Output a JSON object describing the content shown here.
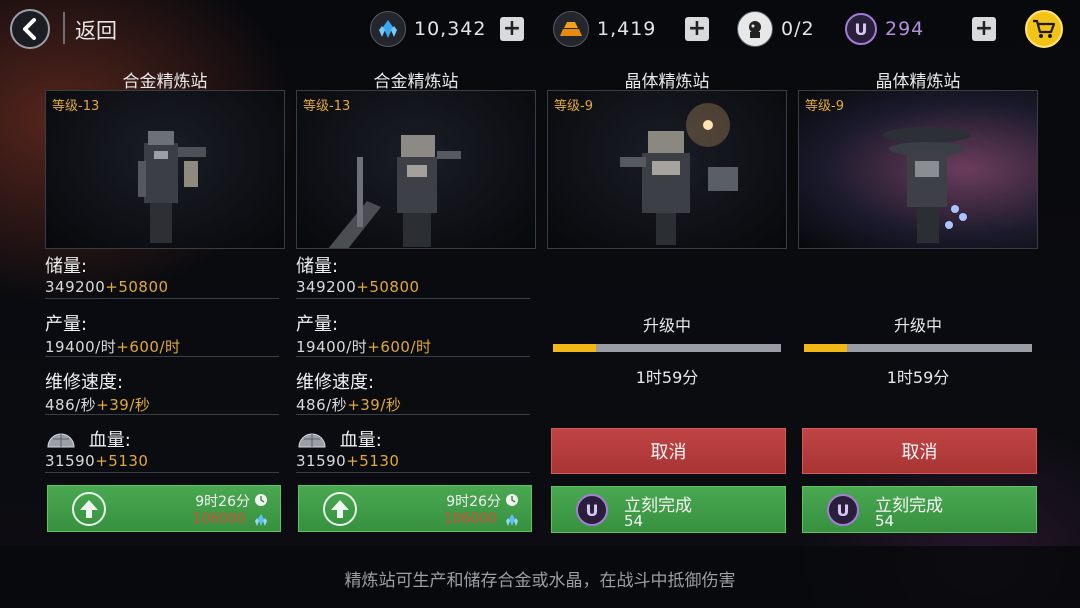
{
  "nav": {
    "back_label": "返回"
  },
  "resources": {
    "crystal": {
      "icon": "crystal-icon",
      "value": "10,342"
    },
    "alloy": {
      "icon": "alloy-bar-icon",
      "value": "1,419"
    },
    "pilot": {
      "icon": "pilot-icon",
      "value": "0/2"
    },
    "premium": {
      "icon": "u-coin-icon",
      "symbol": "U",
      "value": "294"
    }
  },
  "cards": [
    {
      "title": "合金精炼站",
      "level": "等级-13",
      "state": "upgrade",
      "storage_label": "储量:",
      "storage_value": "349200",
      "storage_bonus": "+50800",
      "production_label": "产量:",
      "production_value": "19400/时",
      "production_bonus": "+600/时",
      "repair_label": "维修速度:",
      "repair_value": "486/秒",
      "repair_bonus": "+39/秒",
      "hp_label": "血量:",
      "hp_value": "31590",
      "hp_bonus": "+5130",
      "upgrade_time": "9时26分",
      "upgrade_cost": "106000"
    },
    {
      "title": "合金精炼站",
      "level": "等级-13",
      "state": "upgrade",
      "storage_label": "储量:",
      "storage_value": "349200",
      "storage_bonus": "+50800",
      "production_label": "产量:",
      "production_value": "19400/时",
      "production_bonus": "+600/时",
      "repair_label": "维修速度:",
      "repair_value": "486/秒",
      "repair_bonus": "+39/秒",
      "hp_label": "血量:",
      "hp_value": "31590",
      "hp_bonus": "+5130",
      "upgrade_time": "9时26分",
      "upgrade_cost": "106000"
    },
    {
      "title": "晶体精炼站",
      "level": "等级-9",
      "state": "upgrading",
      "progress_label": "升级中",
      "progress_fraction": 0.19,
      "remaining": "1时59分",
      "cancel_label": "取消",
      "finish_label": "立刻完成",
      "finish_cost": "54"
    },
    {
      "title": "晶体精炼站",
      "level": "等级-9",
      "state": "upgrading",
      "progress_label": "升级中",
      "progress_fraction": 0.19,
      "remaining": "1时59分",
      "cancel_label": "取消",
      "finish_label": "立刻完成",
      "finish_cost": "54"
    }
  ],
  "footer": {
    "text": "精炼站可生产和储存合金或水晶，在战斗中抵御伤害"
  },
  "colors": {
    "bonus": "#e0a93a",
    "upgrade_green": "#3f9c47",
    "cancel_red": "#b33b3b",
    "progress_yellow": "#f2b617",
    "premium_purple": "#a77cd9"
  }
}
